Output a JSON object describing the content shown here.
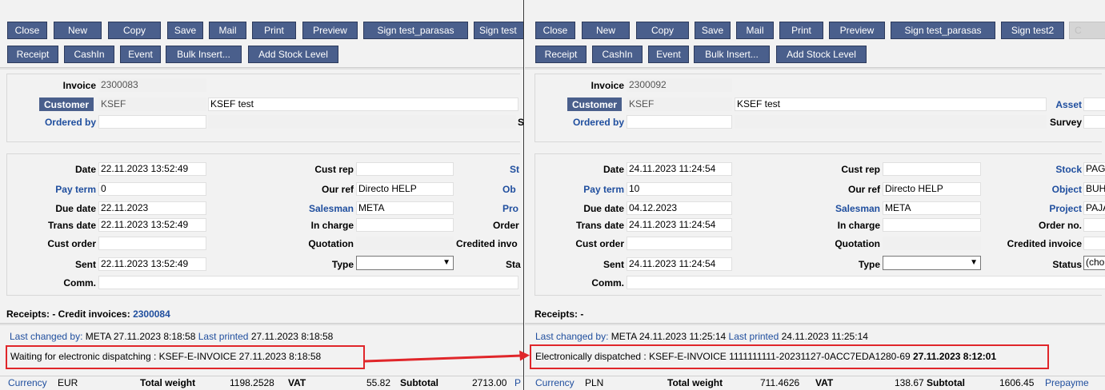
{
  "left": {
    "buttons_row1": [
      "Close",
      "New",
      "Copy",
      "Save",
      "Mail",
      "Print",
      "Preview",
      "Sign test_parasas",
      "Sign test"
    ],
    "buttons_row2": [
      "Receipt",
      "CashIn",
      "Event",
      "Bulk Insert...",
      "Add Stock Level"
    ],
    "head": {
      "invoice_label": "Invoice",
      "invoice_value": "2300083",
      "customer_label": "Customer",
      "customer_code": "KSEF",
      "customer_name": "KSEF test",
      "ordered_by_label": "Ordered by",
      "right_cut_label": "S"
    },
    "fields": {
      "date_label": "Date",
      "date_value": "22.11.2023 13:52:49",
      "pay_term_label": "Pay term",
      "pay_term_value": "0",
      "due_date_label": "Due date",
      "due_date_value": "22.11.2023",
      "trans_date_label": "Trans date",
      "trans_date_value": "22.11.2023 13:52:49",
      "cust_order_label": "Cust order",
      "sent_label": "Sent",
      "sent_value": "22.11.2023 13:52:49",
      "comm_label": "Comm.",
      "cust_rep_label": "Cust rep",
      "our_ref_label": "Our ref",
      "our_ref_value": "Directo HELP",
      "salesman_label": "Salesman",
      "salesman_value": "META",
      "in_charge_label": "In charge",
      "quotation_label": "Quotation",
      "type_label": "Type",
      "cut_st": "St",
      "cut_ob": "Ob",
      "cut_pro": "Pro",
      "cut_order": "Order",
      "cut_credited": "Credited invo",
      "cut_sta": "Sta"
    },
    "receipts_text": "Receipts: - Credit invoices:",
    "receipts_link": "2300084",
    "last_changed_label": "Last changed by:",
    "last_changed_value": "META 27.11.2023 8:18:58",
    "last_printed_label": "Last printed",
    "last_printed_value": "27.11.2023 8:18:58",
    "status_line": "Waiting for electronic dispatching : KSEF-E-INVOICE 27.11.2023 8:18:58",
    "footer": {
      "currency_label": "Currency",
      "currency_value": "EUR",
      "weight_label": "Total weight",
      "weight_value": "1198.2528",
      "vat_label": "VAT",
      "vat_value": "55.82",
      "subtotal_label": "Subtotal",
      "subtotal_value": "2713.00",
      "cut": "P"
    }
  },
  "right": {
    "buttons_row1": [
      "Close",
      "New",
      "Copy",
      "Save",
      "Mail",
      "Print",
      "Preview",
      "Sign test_parasas",
      "Sign test2",
      "C"
    ],
    "buttons_row2": [
      "Receipt",
      "CashIn",
      "Event",
      "Bulk Insert...",
      "Add Stock Level"
    ],
    "head": {
      "invoice_label": "Invoice",
      "invoice_value": "2300092",
      "customer_label": "Customer",
      "customer_code": "KSEF",
      "customer_name": "KSEF test",
      "ordered_by_label": "Ordered by",
      "asset_label": "Asset",
      "survey_label": "Survey"
    },
    "fields": {
      "date_label": "Date",
      "date_value": "24.11.2023 11:24:54",
      "pay_term_label": "Pay term",
      "pay_term_value": "10",
      "due_date_label": "Due date",
      "due_date_value": "04.12.2023",
      "trans_date_label": "Trans date",
      "trans_date_value": "24.11.2023 11:24:54",
      "cust_order_label": "Cust order",
      "sent_label": "Sent",
      "sent_value": "24.11.2023 11:24:54",
      "comm_label": "Comm.",
      "cust_rep_label": "Cust rep",
      "our_ref_label": "Our ref",
      "our_ref_value": "Directo HELP",
      "salesman_label": "Salesman",
      "salesman_value": "META",
      "in_charge_label": "In charge",
      "quotation_label": "Quotation",
      "type_label": "Type",
      "stock_label": "Stock",
      "stock_value": "PAGI",
      "object_label": "Object",
      "object_value": "BUH",
      "project_label": "Project",
      "project_value": "PAJA",
      "order_no_label": "Order no.",
      "credited_label": "Credited invoice",
      "status_label": "Status",
      "status_value": "(cho"
    },
    "receipts_text": "Receipts: -",
    "last_changed_label": "Last changed by:",
    "last_changed_value": "META 24.11.2023 11:25:14",
    "last_printed_label": "Last printed",
    "last_printed_value": "24.11.2023 11:25:14",
    "status_line": "Electronically dispatched : KSEF-E-INVOICE 1111111111-20231127-0ACC7EDA1280-69",
    "status_line_bold": "27.11.2023 8:12:01",
    "footer": {
      "currency_label": "Currency",
      "currency_value": "PLN",
      "weight_label": "Total weight",
      "weight_value": "711.4626",
      "vat_label": "VAT",
      "vat_value": "138.67",
      "subtotal_label": "Subtotal",
      "subtotal_value": "1606.45",
      "cut": "Prepayme"
    }
  },
  "colors": {
    "button": "#4a5f8c",
    "link": "#1f4e9e",
    "highlight": "#e0262a"
  }
}
